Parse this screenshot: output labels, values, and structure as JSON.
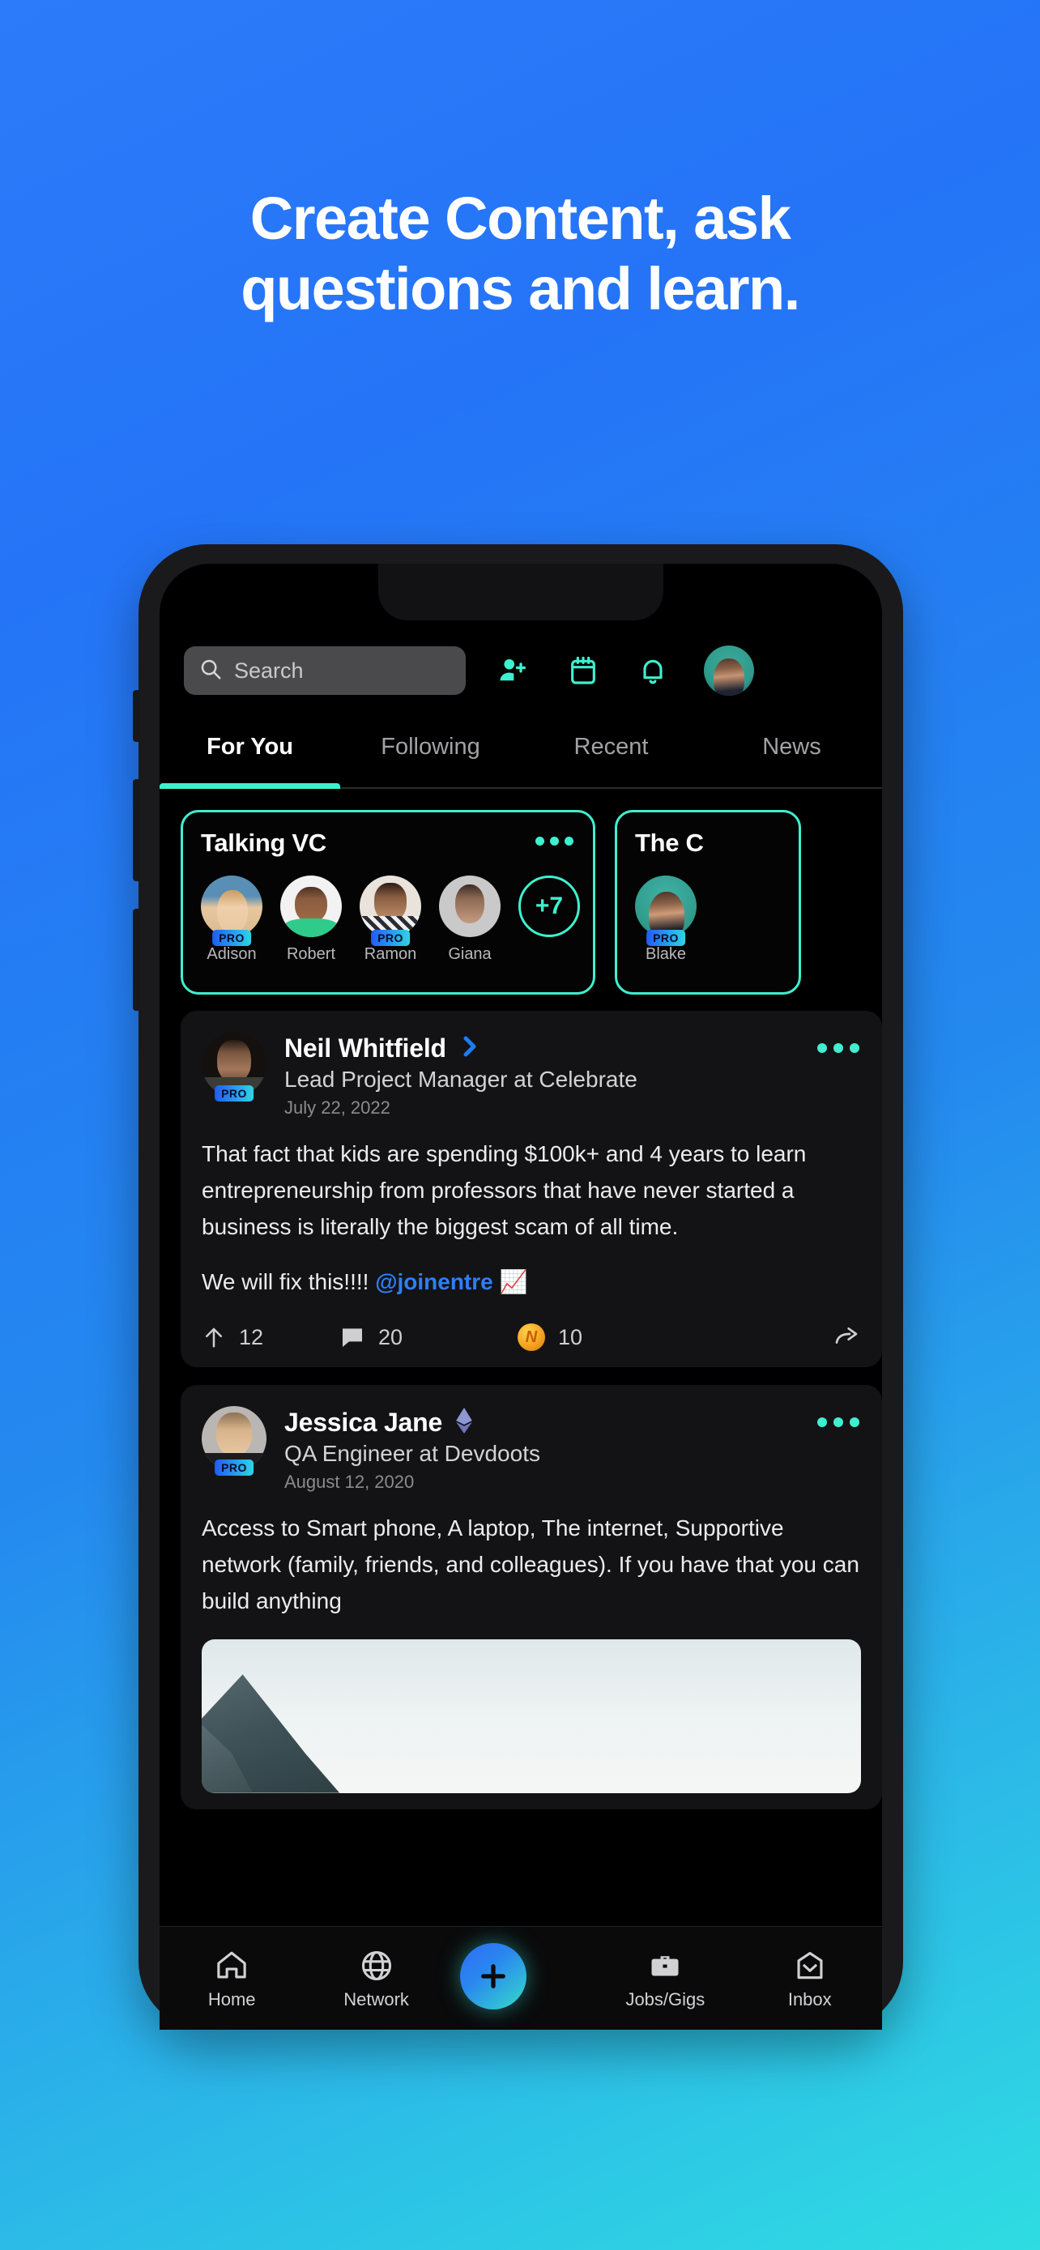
{
  "hero": {
    "line1": "Create Content, ask",
    "line2": "questions and learn."
  },
  "colors": {
    "accent": "#3ef0cf",
    "brand_blue": "#2b7bfa",
    "cyan": "#2fdce2",
    "pro_badge_start": "#1f5cf5",
    "pro_badge_end": "#2fd4e6"
  },
  "topbar": {
    "search_placeholder": "Search",
    "icons": [
      "add-person-icon",
      "calendar-icon",
      "bell-icon",
      "avatar"
    ]
  },
  "tabs": [
    {
      "label": "For You",
      "active": true
    },
    {
      "label": "Following",
      "active": false
    },
    {
      "label": "Recent",
      "active": false
    },
    {
      "label": "News",
      "active": false
    }
  ],
  "stories": [
    {
      "title": "Talking VC",
      "overflow": "+7",
      "people": [
        {
          "name": "Adison",
          "pro": true
        },
        {
          "name": "Robert",
          "pro": false
        },
        {
          "name": "Ramon",
          "pro": true
        },
        {
          "name": "Giana",
          "pro": false
        }
      ]
    },
    {
      "title": "The C",
      "people": [
        {
          "name": "Blake",
          "pro": true
        }
      ]
    }
  ],
  "posts": [
    {
      "name": "Neil Whitfield",
      "badge": "chevron-badge-icon",
      "role": "Lead Project Manager at Celebrate",
      "date": "July 22, 2022",
      "pro": "PRO",
      "body_1": "That fact that kids are spending $100k+ and 4 years to learn entrepreneurship from professors that have never started a business is literally the biggest scam of all time.",
      "body_2_prefix": "We will fix this!!!! ",
      "body_2_mention": "@joinentre",
      "body_2_suffix": " 📈",
      "upvotes": "12",
      "comments": "20",
      "coins": "10"
    },
    {
      "name": "Jessica Jane",
      "badge": "ethereum-badge-icon",
      "role": "QA Engineer at Devdoots",
      "date": "August 12, 2020",
      "pro": "PRO",
      "body_1": "Access to Smart phone, A laptop, The internet, Supportive network (family, friends, and colleagues). If you have that you can build anything"
    }
  ],
  "bottomnav": [
    {
      "label": "Home",
      "icon": "home-icon"
    },
    {
      "label": "Network",
      "icon": "globe-icon"
    },
    {
      "label": "",
      "icon": "plus-fab-icon"
    },
    {
      "label": "Jobs/Gigs",
      "icon": "briefcase-icon"
    },
    {
      "label": "Inbox",
      "icon": "inbox-icon"
    }
  ]
}
